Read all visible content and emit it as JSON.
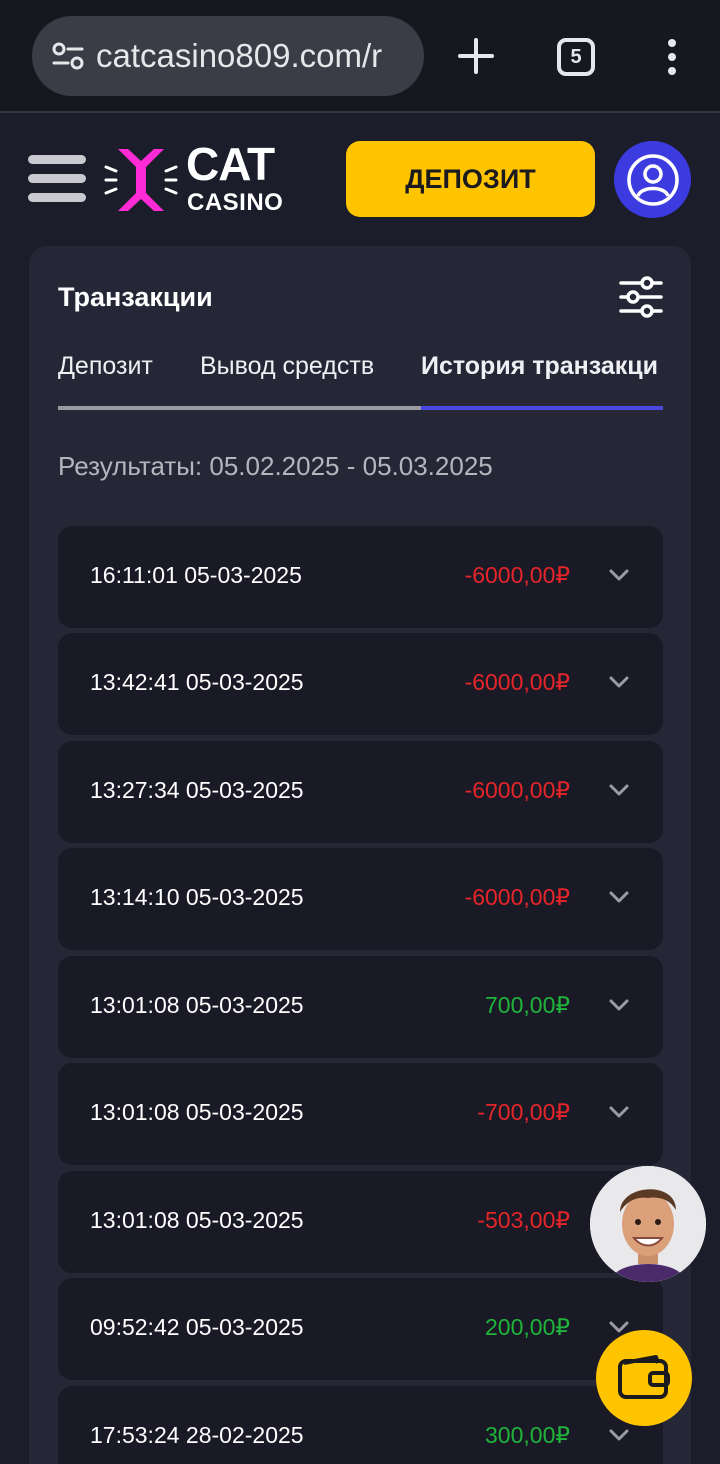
{
  "browser": {
    "url": "catcasino809.com/r",
    "tab_count": "5"
  },
  "header": {
    "logo_line1": "CAT",
    "logo_line2": "CASINO",
    "deposit_label": "ДЕПОЗИТ"
  },
  "card": {
    "title": "Транзакции",
    "tabs": [
      {
        "label": "Депозит"
      },
      {
        "label": "Вывод средств"
      },
      {
        "label": "История транзакци"
      }
    ],
    "results_label": "Результаты:",
    "results_range": "05.02.2025 - 05.03.2025"
  },
  "transactions": [
    {
      "time": "16:11:01 05-03-2025",
      "amount": "-6000,00₽",
      "color": "#e5252a"
    },
    {
      "time": "13:42:41 05-03-2025",
      "amount": "-6000,00₽",
      "color": "#e5252a"
    },
    {
      "time": "13:27:34 05-03-2025",
      "amount": "-6000,00₽",
      "color": "#e5252a"
    },
    {
      "time": "13:14:10 05-03-2025",
      "amount": "-6000,00₽",
      "color": "#e5252a"
    },
    {
      "time": "13:01:08 05-03-2025",
      "amount": "700,00₽",
      "color": "#1fb53a"
    },
    {
      "time": "13:01:08 05-03-2025",
      "amount": "-700,00₽",
      "color": "#e5252a"
    },
    {
      "time": "13:01:08 05-03-2025",
      "amount": "-503,00₽",
      "color": "#e5252a"
    },
    {
      "time": "09:52:42 05-03-2025",
      "amount": "200,00₽",
      "color": "#1fb53a"
    },
    {
      "time": "17:53:24 28-02-2025",
      "amount": "300,00₽",
      "color": "#1fb53a"
    }
  ],
  "colors": {
    "accent_yellow": "#ffc400",
    "accent_blue": "#3b3be0",
    "negative": "#e5252a",
    "positive": "#1fb53a"
  }
}
